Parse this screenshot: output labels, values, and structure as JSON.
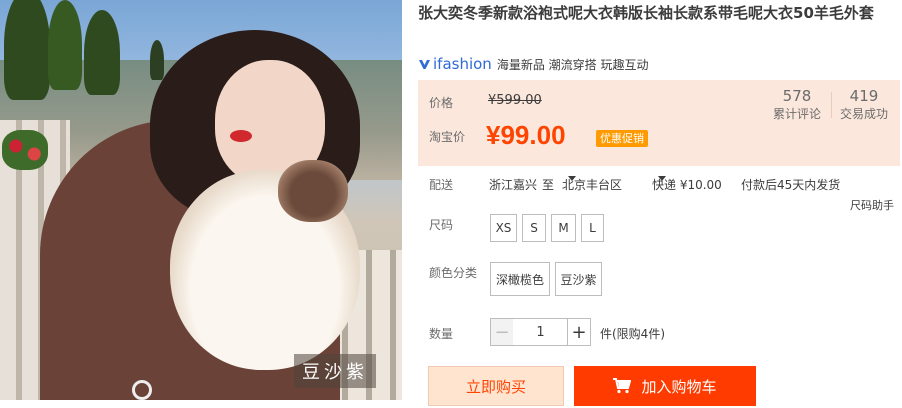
{
  "product": {
    "title": "张大奕冬季新款浴袍式呢大衣韩版长袖长款系带毛呢大衣50羊毛外套",
    "image_watermark": "豆沙紫"
  },
  "brand": {
    "logo_text": "ifashion",
    "tagline": "海量新品 潮流穿搭 玩趣互动",
    "color": "#2f6ad6"
  },
  "price": {
    "original_label": "价格",
    "original_value": "¥599.00",
    "sale_label": "淘宝价",
    "sale_value": "¥99.00",
    "promo_badge": "优惠促销",
    "accent_color": "#ff4400"
  },
  "stats": {
    "reviews_count": "578",
    "reviews_label": "累计评论",
    "sales_count": "419",
    "sales_label": "交易成功"
  },
  "shipping": {
    "label": "配送",
    "origin": "浙江嘉兴",
    "to_word": "至",
    "destination": "北京丰台区",
    "method": "快递 ¥10.00",
    "dispatch": "付款后45天内发货",
    "size_helper": "尺码助手"
  },
  "size": {
    "label": "尺码",
    "options": [
      "XS",
      "S",
      "M",
      "L"
    ]
  },
  "color": {
    "label": "颜色分类",
    "options": [
      "深橄榄色",
      "豆沙紫"
    ]
  },
  "quantity": {
    "label": "数量",
    "value": "1",
    "minus": "−",
    "plus": "+",
    "unit_text": "件(限购4件)"
  },
  "actions": {
    "buy_now": "立即购买",
    "add_to_cart": "加入购物车"
  }
}
